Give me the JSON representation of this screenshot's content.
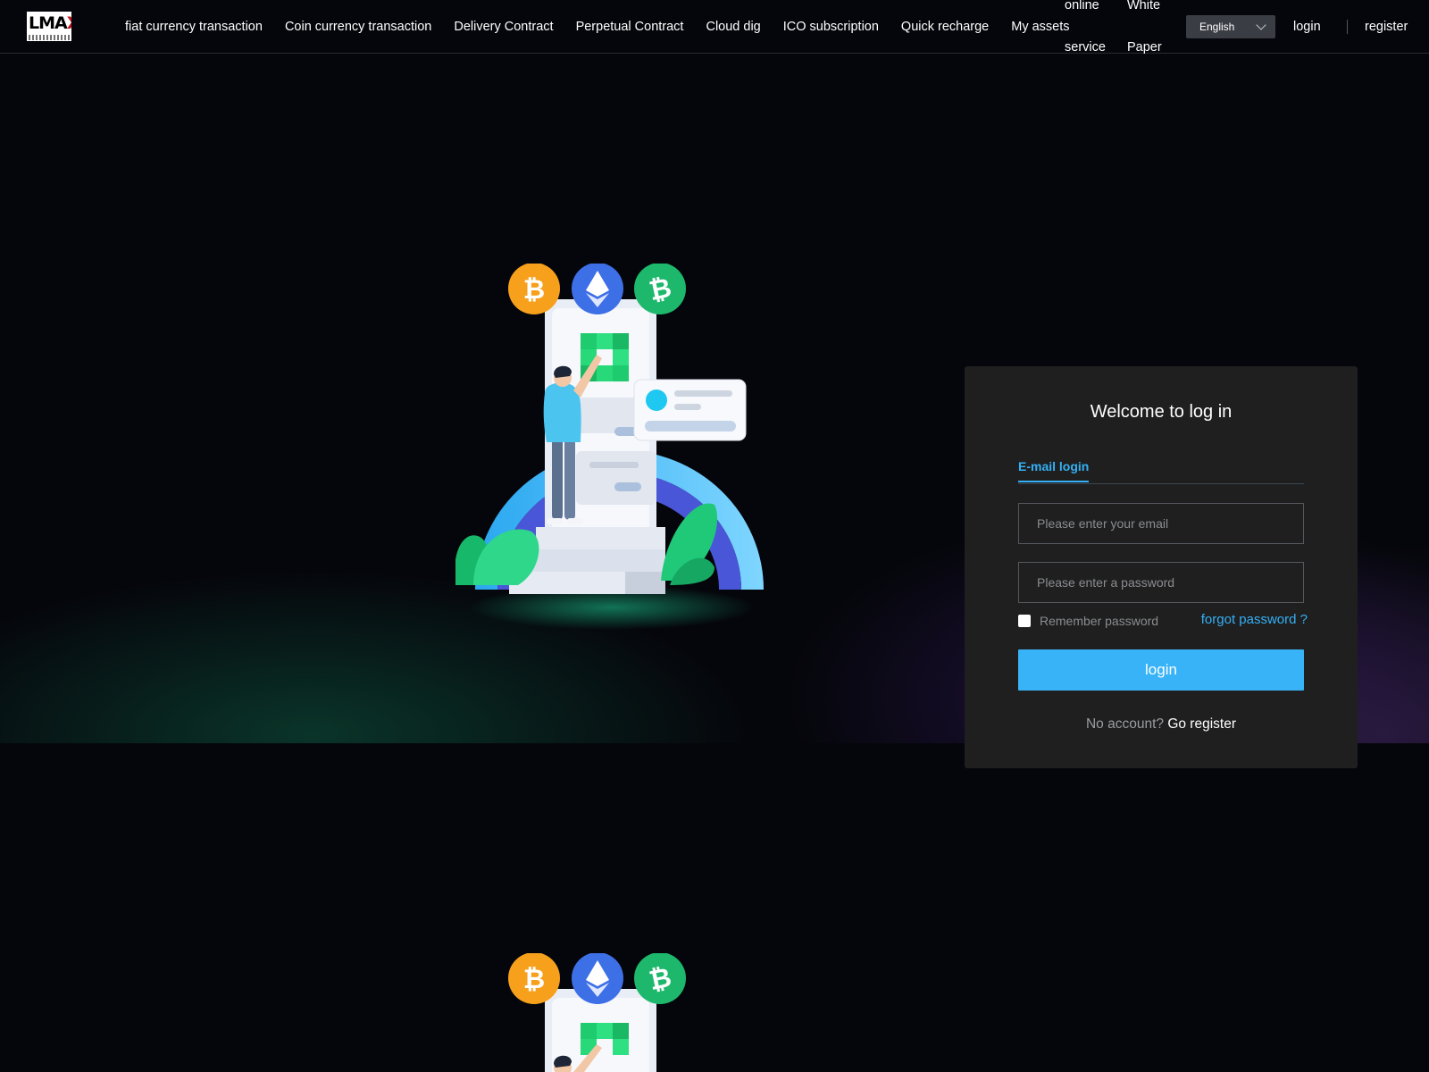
{
  "header": {
    "logo_text_main": "LMA",
    "logo_text_x": "X",
    "nav": [
      {
        "label": "fiat currency transaction"
      },
      {
        "label": "Coin currency transaction"
      },
      {
        "label": "Delivery Contract"
      },
      {
        "label": "Perpetual Contract"
      },
      {
        "label": "Cloud dig"
      },
      {
        "label": "ICO subscription"
      },
      {
        "label": "Quick recharge"
      },
      {
        "label": "My assets"
      }
    ],
    "online_service": {
      "line1": "online",
      "line2": "service"
    },
    "white_paper": {
      "line1": "White",
      "line2": "Paper"
    },
    "language": "English",
    "login_label": "login",
    "register_label": "register"
  },
  "login_panel": {
    "title": "Welcome to log in",
    "tab_email": "E-mail login",
    "email_placeholder": "Please enter your email",
    "password_placeholder": "Please enter a password",
    "remember_label": "Remember password",
    "forgot_label": "forgot password ?",
    "login_button": "login",
    "no_account": "No account?",
    "go_register": "Go register"
  },
  "colors": {
    "accent": "#38b3f7",
    "background": "#05060b",
    "panel": "#1f1f1f",
    "bitcoin": "#f7a01c",
    "ethereum": "#3d6fe6",
    "bitcoin_cash": "#1db86c"
  },
  "icons": [
    "bitcoin-coin-icon",
    "ethereum-coin-icon",
    "bitcoin-cash-coin-icon",
    "chevron-down-icon"
  ]
}
